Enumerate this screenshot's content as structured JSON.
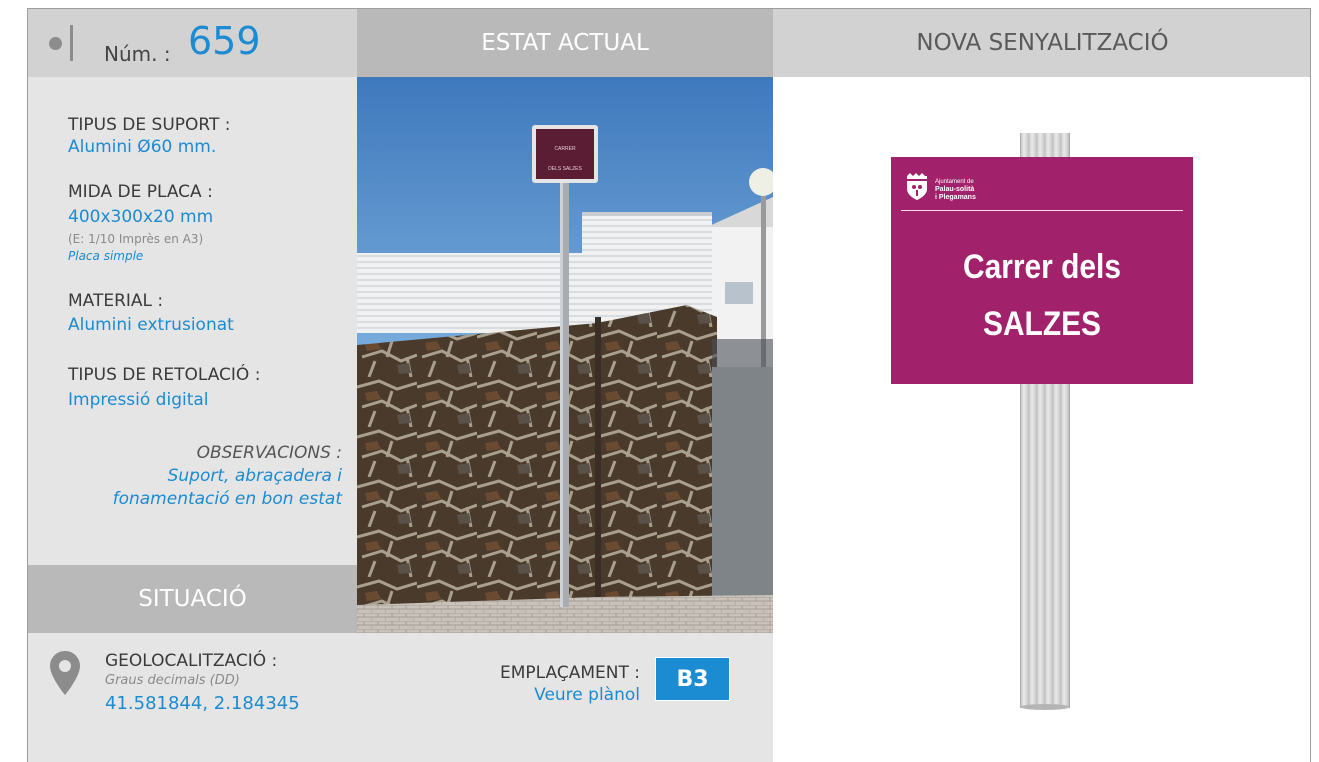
{
  "header": {
    "num_label": "Núm. :",
    "num_value": "659",
    "estat_actual": "ESTAT ACTUAL",
    "nova_senyalitzacio": "NOVA SENYALITZACIÓ"
  },
  "specs": {
    "suport_label": "TIPUS DE SUPORT :",
    "suport_value": "Alumini Ø60 mm.",
    "mida_label": "MIDA DE PLACA :",
    "mida_value": "400x300x20 mm",
    "mida_note": "(E: 1/10 Imprès en A3)",
    "mida_type": "Placa simple",
    "material_label": "MATERIAL :",
    "material_value": "Alumini extrusionat",
    "retolacio_label": "TIPUS DE RETOLACIÓ :",
    "retolacio_value": "Impressió digital",
    "observacions_label": "OBSERVACIONS :",
    "observacions_line1": "Suport, abraçadera i",
    "observacions_line2": "fonamentació en bon estat"
  },
  "situacio": {
    "title": "SITUACIÓ",
    "geo_label": "GEOLOCALITZACIÓ :",
    "geo_format": "Graus decimals (DD)",
    "geo_value": "41.581844, 2.184345",
    "emplacament_label": "EMPLAÇAMENT :",
    "emplacament_link": "Veure plànol",
    "emplacament_code": "B3"
  },
  "photo_sign": {
    "line1": "CARRER",
    "line2": "DELS SALZES"
  },
  "new_sign": {
    "logo_line1": "Ajuntament de",
    "logo_line2": "Palau-solità",
    "logo_line3": "i Plegamans",
    "line1": "Carrer dels",
    "line2": "SALZES",
    "color": "#a1226a"
  },
  "colors": {
    "accent_blue": "#1b8bd2",
    "header_dark": "#b9b9b9",
    "header_light": "#d2d2d2",
    "panel": "#e5e5e5"
  }
}
